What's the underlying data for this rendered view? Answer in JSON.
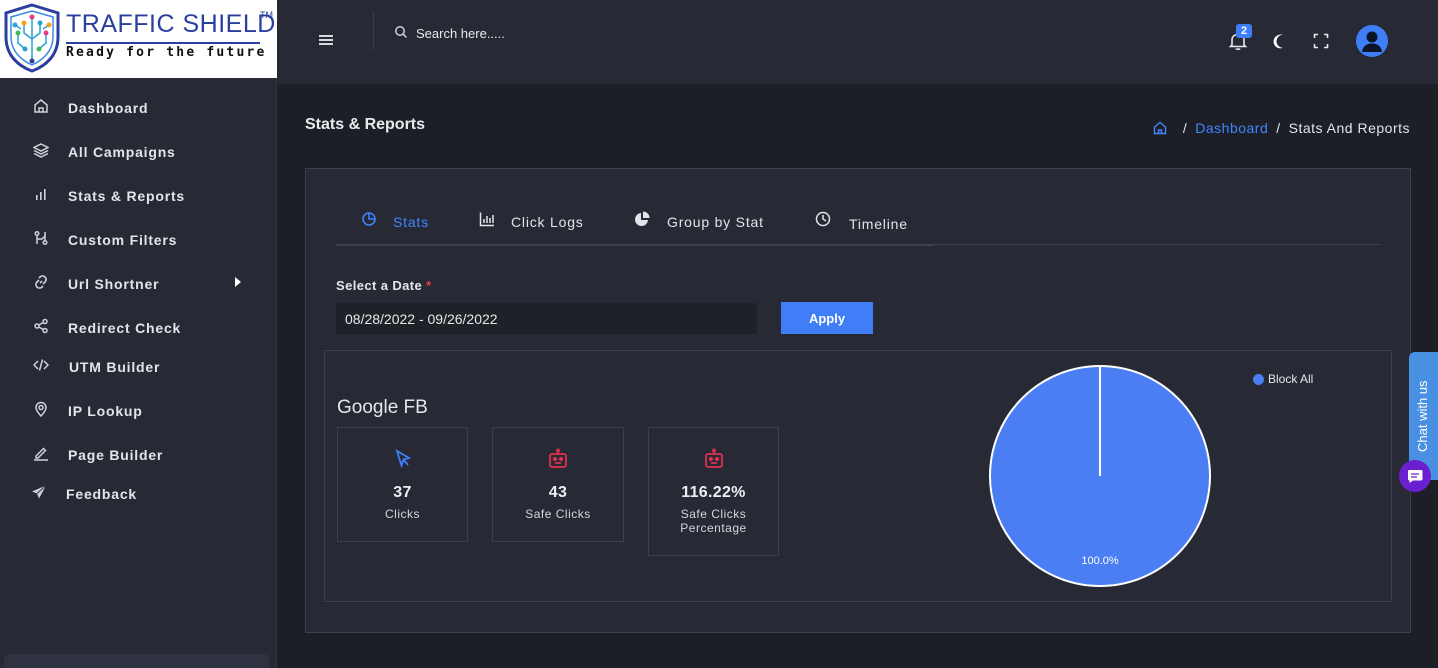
{
  "brand": {
    "title": "TRAFFIC SHIELD",
    "trademark": "TM",
    "tagline": "Ready for the future"
  },
  "sidebar": {
    "items": [
      {
        "label": "Dashboard",
        "icon": "home-icon"
      },
      {
        "label": "All Campaigns",
        "icon": "layers-icon"
      },
      {
        "label": "Stats & Reports",
        "icon": "bar-chart-icon"
      },
      {
        "label": "Custom Filters",
        "icon": "filter-icon"
      },
      {
        "label": "Url Shortner",
        "icon": "link-icon",
        "has_submenu": true
      },
      {
        "label": "Redirect Check",
        "icon": "share-icon"
      },
      {
        "label": "UTM Builder",
        "icon": "code-icon"
      },
      {
        "label": "IP Lookup",
        "icon": "map-pin-icon"
      },
      {
        "label": "Page Builder",
        "icon": "edit-icon"
      },
      {
        "label": "Feedback",
        "icon": "send-icon"
      }
    ]
  },
  "topbar": {
    "search_placeholder": "Search here.....",
    "notification_count": "2"
  },
  "page": {
    "title": "Stats & Reports",
    "breadcrumb": {
      "link": "Dashboard",
      "current": "Stats And Reports"
    }
  },
  "tabs": [
    {
      "label": "Stats",
      "icon": "pie-chart-outline-icon",
      "active": true
    },
    {
      "label": "Click Logs",
      "icon": "bar-chart-icon",
      "active": false
    },
    {
      "label": "Group by Stat",
      "icon": "pie-chart-icon",
      "active": false
    },
    {
      "label": "Timeline",
      "icon": "clock-icon",
      "active": false
    }
  ],
  "filter": {
    "label": "Select a Date",
    "required_mark": "*",
    "date_range": "08/28/2022 - 09/26/2022",
    "apply_label": "Apply"
  },
  "campaign": {
    "name": "Google FB",
    "stats": [
      {
        "value": "37",
        "label": "Clicks",
        "icon": "cursor-icon",
        "color": "#3f7ef7"
      },
      {
        "value": "43",
        "label": "Safe Clicks",
        "icon": "robot-icon",
        "color": "#e0304e"
      },
      {
        "value": "116.22%",
        "label": "Safe Clicks Percentage",
        "icon": "robot-icon",
        "color": "#e0304e"
      }
    ]
  },
  "chart_data": {
    "type": "pie",
    "categories": [
      "Block All"
    ],
    "values": [
      100.0
    ],
    "labels": [
      "100.0%"
    ],
    "colors": [
      "#4a7ef2"
    ],
    "legend": "top-right"
  },
  "chat": {
    "label": "Chat with us"
  },
  "colors": {
    "accent": "#3f7ef7",
    "link": "#3f86ff",
    "danger": "#e0304e",
    "chat_bubble": "#6a1fd0"
  }
}
